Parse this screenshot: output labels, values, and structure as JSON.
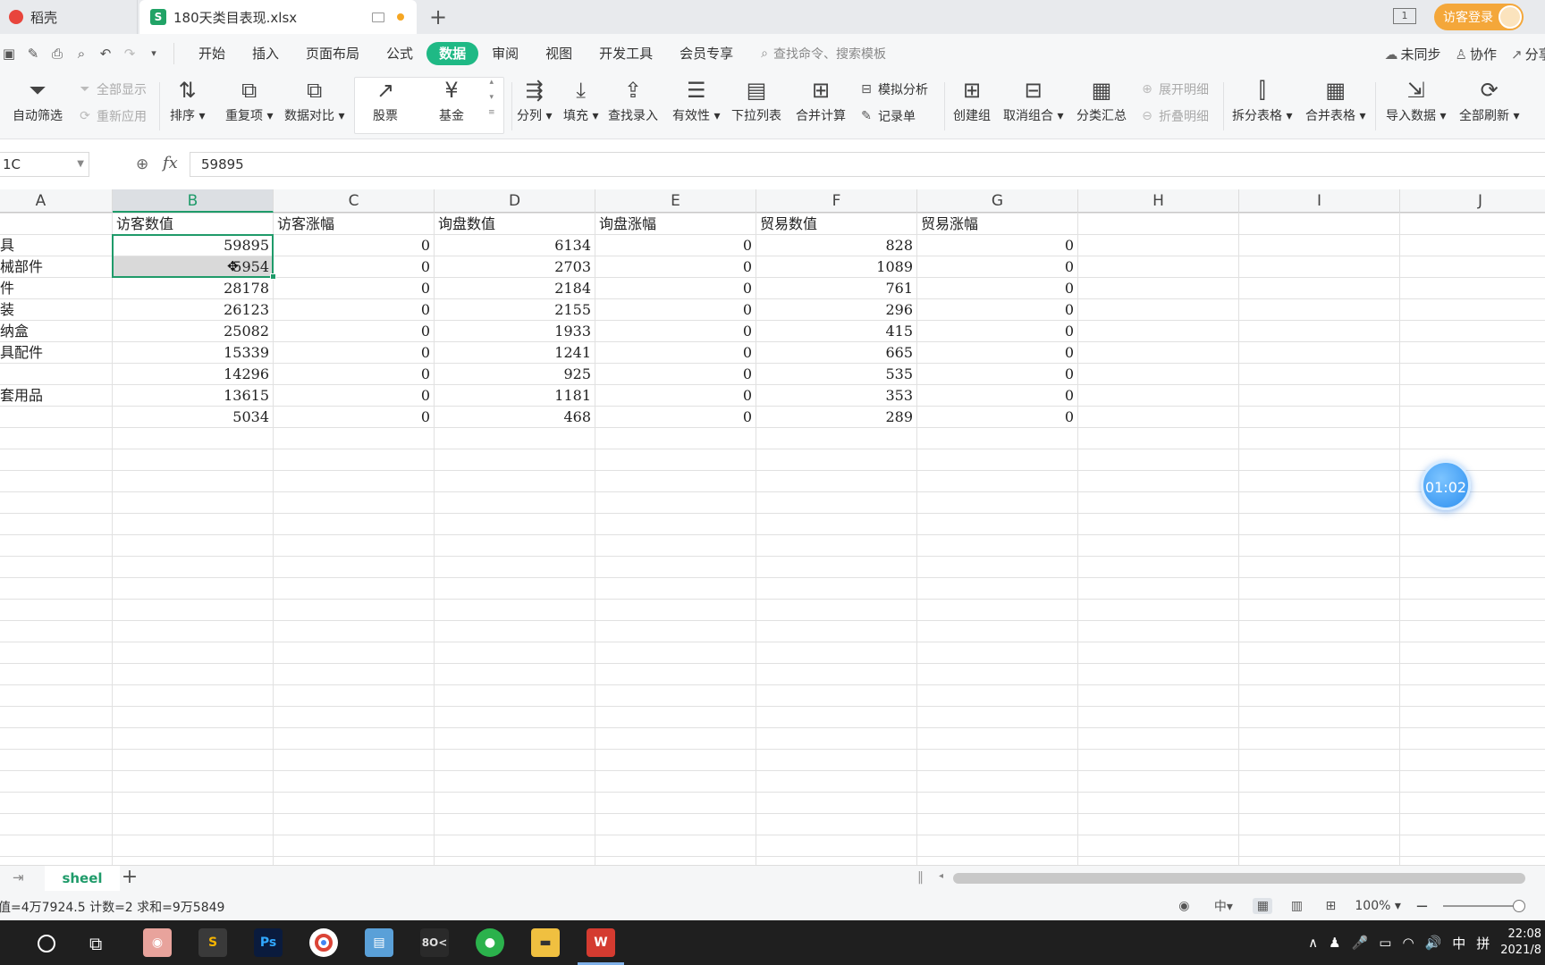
{
  "tabs": {
    "app_tab": "稻壳",
    "file_tab": "180天类目表现.xlsx"
  },
  "account": {
    "login_label": "访客登录",
    "window_count": "1"
  },
  "menu": {
    "items": [
      "开始",
      "插入",
      "页面布局",
      "公式",
      "数据",
      "审阅",
      "视图",
      "开发工具",
      "会员专享"
    ],
    "active": "数据",
    "search_placeholder": "查找命令、搜索模板",
    "sync": "未同步",
    "collab": "协作",
    "share": "分享"
  },
  "ribbon": {
    "auto_filter": "自动筛选",
    "show_all": "全部显示",
    "reapply": "重新应用",
    "sort": "排序",
    "duplicates": "重复项",
    "compare": "数据对比",
    "stock": "股票",
    "fund": "基金",
    "split_col": "分列",
    "fill": "填充",
    "lookup_entry": "查找录入",
    "validity": "有效性",
    "dropdown_list": "下拉列表",
    "consolidate": "合并计算",
    "what_if": "模拟分析",
    "record_form": "记录单",
    "create_group": "创建组",
    "ungroup": "取消组合",
    "subtotal": "分类汇总",
    "expand_detail": "展开明细",
    "collapse_detail": "折叠明细",
    "split_table": "拆分表格",
    "merge_table": "合并表格",
    "import_data": "导入数据",
    "refresh_all": "全部刷新"
  },
  "formula_bar": {
    "name_box": "1C",
    "fx_label": "fx",
    "value": "59895"
  },
  "columns": [
    "A",
    "B",
    "C",
    "D",
    "E",
    "F",
    "G",
    "H",
    "I",
    "J"
  ],
  "selected_column": "B",
  "header_row": [
    "",
    "访客数值",
    "访客涨幅",
    "询盘数值",
    "询盘涨幅",
    "贸易数值",
    "贸易涨幅"
  ],
  "rows": [
    [
      "具",
      "59895",
      "0",
      "6134",
      "0",
      "828",
      "0"
    ],
    [
      "械部件",
      "5954",
      "0",
      "2703",
      "0",
      "1089",
      "0"
    ],
    [
      "件",
      "28178",
      "0",
      "2184",
      "0",
      "761",
      "0"
    ],
    [
      "装",
      "26123",
      "0",
      "2155",
      "0",
      "296",
      "0"
    ],
    [
      "纳盒",
      "25082",
      "0",
      "1933",
      "0",
      "415",
      "0"
    ],
    [
      "具配件",
      "15339",
      "0",
      "1241",
      "0",
      "665",
      "0"
    ],
    [
      "",
      "14296",
      "0",
      "925",
      "0",
      "535",
      "0"
    ],
    [
      "套用品",
      "13615",
      "0",
      "1181",
      "0",
      "353",
      "0"
    ],
    [
      "",
      "5034",
      "0",
      "468",
      "0",
      "289",
      "0"
    ]
  ],
  "timer": "01:02",
  "sheet": {
    "name": "sheel"
  },
  "status": {
    "summary": "值=4万7924.5  计数=2  求和=9万5849",
    "zoom": "100%"
  },
  "taskbar": {
    "ime": "中",
    "time": "22:08",
    "date": "2021/8"
  }
}
